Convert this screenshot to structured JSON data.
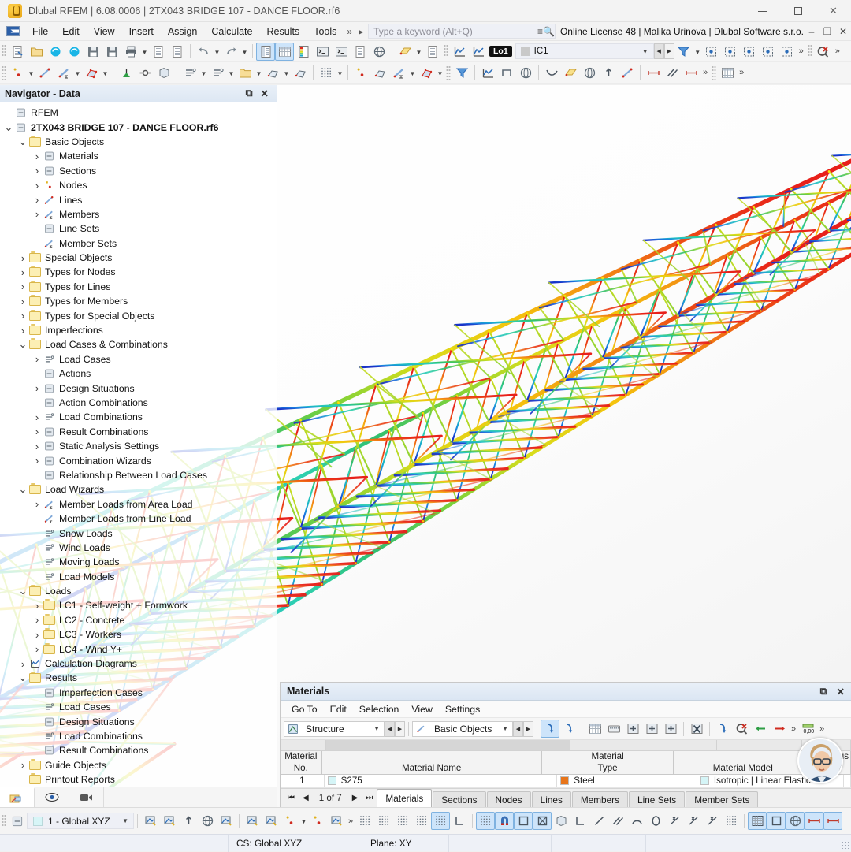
{
  "window": {
    "title": "Dlubal RFEM | 6.08.0006 | 2TX043 BRIDGE 107 - DANCE FLOOR.rf6",
    "app_icon": "dlubal-logo-icon",
    "minimize": "minimize-icon",
    "maximize": "maximize-icon",
    "close": "close-icon"
  },
  "menubar": {
    "items": [
      "File",
      "Edit",
      "View",
      "Insert",
      "Assign",
      "Calculate",
      "Results",
      "Tools"
    ],
    "overflow": "»",
    "expander": "▸",
    "search_placeholder": "Type a keyword (Alt+Q)",
    "license": "Online License 48 | Malika Urinova | Dlubal Software s.r.o.",
    "license_icon": "license-list-icon",
    "min": "–",
    "restore": "❐",
    "close": "✕"
  },
  "toolbar1": {
    "buttons": [
      "new-model-icon",
      "open-folder-icon",
      "cloud-connect-icon",
      "cloud-model-icon",
      "save-as-icon",
      "save-icon",
      "print-icon",
      "new-report-icon",
      "document-icon",
      "undo-icon",
      "redo-icon",
      "navigator-panel-icon",
      "table-panel-icon",
      "color-legend-icon",
      "console-icon",
      "script-icon",
      "info-panel-icon",
      "globe-view-icon",
      "section-plane-icon",
      "annotation-icon",
      "result-diagram-icon",
      "result-diagram2-icon",
      "filter-clear-icon",
      "visibility-icon",
      "deselect-icon",
      "select-down-icon",
      "select-all-icon",
      "box-select-icon",
      "delete-results-icon"
    ],
    "lo_badge": "Lo1",
    "ic_value": "IC1",
    "overflow": "»"
  },
  "toolbar2": {
    "buttons": [
      "new-node-icon",
      "new-line-icon",
      "new-member-icon",
      "new-surface-icon",
      "new-solid-icon",
      "new-support-icon",
      "new-hinge-icon",
      "new-load-icon",
      "wind-load-icon",
      "opening-icon",
      "rib-icon",
      "stiffener-icon",
      "mesh-icon",
      "node-set-icon",
      "line-grid-icon",
      "member-set-icon",
      "surface-set-icon",
      "filter-icon",
      "diagram-icon",
      "frame-icon",
      "render-icon",
      "deformation-icon",
      "plate-icon",
      "cube-view-icon",
      "move-icon",
      "line-tool-icon",
      "dim-horizontal-icon",
      "dim-dashed-icon",
      "dim-dotted-icon",
      "grid-table-icon"
    ],
    "overflow": "»"
  },
  "navigator": {
    "title": "Navigator - Data",
    "undock_icon": "undock-icon",
    "close_icon": "close-icon",
    "bottom_tabs": [
      "navigator-data-icon",
      "visibility-eye-icon",
      "camera-icon"
    ],
    "tree": [
      {
        "depth": 0,
        "chev": "",
        "icon": "rfem-icon",
        "label": "RFEM",
        "bold": false
      },
      {
        "depth": 0,
        "chev": "open",
        "icon": "model-icon",
        "label": "2TX043 BRIDGE 107 - DANCE FLOOR.rf6",
        "bold": true
      },
      {
        "depth": 1,
        "chev": "open",
        "icon": "folder",
        "label": "Basic Objects",
        "bold": false
      },
      {
        "depth": 2,
        "chev": "closed",
        "icon": "materials-icon",
        "label": "Materials",
        "bold": false
      },
      {
        "depth": 2,
        "chev": "closed",
        "icon": "sections-icon",
        "label": "Sections",
        "bold": false
      },
      {
        "depth": 2,
        "chev": "closed",
        "icon": "nodes-icon",
        "label": "Nodes",
        "bold": false
      },
      {
        "depth": 2,
        "chev": "closed",
        "icon": "lines-icon",
        "label": "Lines",
        "bold": false
      },
      {
        "depth": 2,
        "chev": "closed",
        "icon": "members-icon",
        "label": "Members",
        "bold": false
      },
      {
        "depth": 2,
        "chev": "",
        "icon": "line-sets-icon",
        "label": "Line Sets",
        "bold": false
      },
      {
        "depth": 2,
        "chev": "",
        "icon": "member-sets-icon",
        "label": "Member Sets",
        "bold": false
      },
      {
        "depth": 1,
        "chev": "closed",
        "icon": "folder",
        "label": "Special Objects",
        "bold": false
      },
      {
        "depth": 1,
        "chev": "closed",
        "icon": "folder",
        "label": "Types for Nodes",
        "bold": false
      },
      {
        "depth": 1,
        "chev": "closed",
        "icon": "folder",
        "label": "Types for Lines",
        "bold": false
      },
      {
        "depth": 1,
        "chev": "closed",
        "icon": "folder",
        "label": "Types for Members",
        "bold": false
      },
      {
        "depth": 1,
        "chev": "closed",
        "icon": "folder",
        "label": "Types for Special Objects",
        "bold": false
      },
      {
        "depth": 1,
        "chev": "closed",
        "icon": "folder",
        "label": "Imperfections",
        "bold": false
      },
      {
        "depth": 1,
        "chev": "open",
        "icon": "folder",
        "label": "Load Cases & Combinations",
        "bold": false
      },
      {
        "depth": 2,
        "chev": "closed",
        "icon": "load-cases-icon",
        "label": "Load Cases",
        "bold": false
      },
      {
        "depth": 2,
        "chev": "",
        "icon": "actions-icon",
        "label": "Actions",
        "bold": false
      },
      {
        "depth": 2,
        "chev": "closed",
        "icon": "design-situations-icon",
        "label": "Design Situations",
        "bold": false
      },
      {
        "depth": 2,
        "chev": "",
        "icon": "action-combinations-icon",
        "label": "Action Combinations",
        "bold": false
      },
      {
        "depth": 2,
        "chev": "closed",
        "icon": "load-combinations-icon",
        "label": "Load Combinations",
        "bold": false
      },
      {
        "depth": 2,
        "chev": "closed",
        "icon": "result-combinations-icon",
        "label": "Result Combinations",
        "bold": false
      },
      {
        "depth": 2,
        "chev": "closed",
        "icon": "static-analysis-icon",
        "label": "Static Analysis Settings",
        "bold": false
      },
      {
        "depth": 2,
        "chev": "closed",
        "icon": "combination-wizards-icon",
        "label": "Combination Wizards",
        "bold": false
      },
      {
        "depth": 2,
        "chev": "",
        "icon": "relationship-icon",
        "label": "Relationship Between Load Cases",
        "bold": false
      },
      {
        "depth": 1,
        "chev": "open",
        "icon": "folder",
        "label": "Load Wizards",
        "bold": false
      },
      {
        "depth": 2,
        "chev": "closed",
        "icon": "member-loads-area-icon",
        "label": "Member Loads from Area Load",
        "bold": false
      },
      {
        "depth": 2,
        "chev": "",
        "icon": "member-loads-line-icon",
        "label": "Member Loads from Line Load",
        "bold": false
      },
      {
        "depth": 2,
        "chev": "",
        "icon": "snow-loads-icon",
        "label": "Snow Loads",
        "bold": false
      },
      {
        "depth": 2,
        "chev": "",
        "icon": "wind-loads-icon",
        "label": "Wind Loads",
        "bold": false
      },
      {
        "depth": 2,
        "chev": "",
        "icon": "moving-loads-icon",
        "label": "Moving Loads",
        "bold": false
      },
      {
        "depth": 2,
        "chev": "",
        "icon": "load-models-icon",
        "label": "Load Models",
        "bold": false
      },
      {
        "depth": 1,
        "chev": "open",
        "icon": "folder",
        "label": "Loads",
        "bold": false
      },
      {
        "depth": 2,
        "chev": "closed",
        "icon": "folder",
        "label": "LC1 - Self-weight + Formwork",
        "bold": false
      },
      {
        "depth": 2,
        "chev": "closed",
        "icon": "folder",
        "label": "LC2 - Concrete",
        "bold": false
      },
      {
        "depth": 2,
        "chev": "closed",
        "icon": "folder",
        "label": "LC3 - Workers",
        "bold": false
      },
      {
        "depth": 2,
        "chev": "closed",
        "icon": "folder",
        "label": "LC4 - Wind Y+",
        "bold": false
      },
      {
        "depth": 1,
        "chev": "closed",
        "icon": "calculation-diagrams-icon",
        "label": "Calculation Diagrams",
        "bold": false
      },
      {
        "depth": 1,
        "chev": "open",
        "icon": "folder",
        "label": "Results",
        "bold": false
      },
      {
        "depth": 2,
        "chev": "",
        "icon": "imperfection-cases-icon",
        "label": "Imperfection Cases",
        "bold": false
      },
      {
        "depth": 2,
        "chev": "",
        "icon": "load-cases-icon",
        "label": "Load Cases",
        "bold": false
      },
      {
        "depth": 2,
        "chev": "",
        "icon": "design-situations-icon",
        "label": "Design Situations",
        "bold": false
      },
      {
        "depth": 2,
        "chev": "",
        "icon": "load-combinations-icon",
        "label": "Load Combinations",
        "bold": false
      },
      {
        "depth": 2,
        "chev": "",
        "icon": "result-combinations-icon",
        "label": "Result Combinations",
        "bold": false
      },
      {
        "depth": 1,
        "chev": "closed",
        "icon": "folder",
        "label": "Guide Objects",
        "bold": false
      },
      {
        "depth": 1,
        "chev": "",
        "icon": "folder",
        "label": "Printout Reports",
        "bold": false
      }
    ]
  },
  "table_panel": {
    "title": "Materials",
    "undock_icon": "undock-icon",
    "close_icon": "close-icon",
    "menu": [
      "Go To",
      "Edit",
      "Selection",
      "View",
      "Settings"
    ],
    "combo1": {
      "icon": "structure-icon",
      "value": "Structure"
    },
    "combo2": {
      "icon": "basic-objects-icon",
      "value": "Basic Objects"
    },
    "tool_icons": [
      "select-in-table-icon",
      "select-in-model-icon",
      "table-view-icon",
      "keyboard-icon",
      "insert-row-icon",
      "insert-cell-icon",
      "column-icon",
      "delete-row-icon",
      "export-icon",
      "clear-icon",
      "import-green-icon",
      "export-red-icon"
    ],
    "overflow": "»",
    "decimals_icon": "decimal-places-icon",
    "decimals_value": "0,00",
    "columns": [
      "Material No.",
      "Material Name",
      "Material Type",
      "Material Model",
      "Modulus E [N/"
    ],
    "columns_multiline": [
      [
        "Material",
        "No."
      ],
      [
        "",
        "Material Name"
      ],
      [
        "Material",
        "Type"
      ],
      [
        "",
        "Material Model"
      ],
      [
        "Modulus",
        "E [N/"
      ]
    ],
    "rows": [
      {
        "no": "1",
        "name": "S275",
        "name_color": "#d5f5f7",
        "type": "Steel",
        "type_color": "#e8751a",
        "model": "Isotropic | Linear Elastic",
        "model_color": "#d5f5f7",
        "modulus": ""
      }
    ],
    "pager": {
      "first": "⏮",
      "prev": "◀",
      "page": "1 of 7",
      "next": "▶",
      "last": "⏭"
    },
    "tabs": [
      "Materials",
      "Sections",
      "Nodes",
      "Lines",
      "Members",
      "Line Sets",
      "Member Sets"
    ],
    "selected_tab": "Materials",
    "avatar": "user-avatar"
  },
  "bottombar": {
    "cs_icon": "coordinate-system-icon",
    "cs_value": "1 - Global XYZ",
    "left_icons": [
      "view-model-icon",
      "view-delete-icon",
      "view-extrude-icon",
      "view-rotate-icon",
      "view-layers-icon",
      "snap-object-icon",
      "snap-grid-icon",
      "snap-point-icon",
      "snap-point2-icon",
      "snap-intersect-icon"
    ],
    "overflow": "»",
    "right_icons": [
      "grid-snap-icon",
      "grid-point-icon",
      "grid-object-icon",
      "grid-line-icon",
      "grid-visible-icon",
      "axis-icon",
      "osnap-grid-icon",
      "osnap-magnet-icon",
      "osnap-square-icon",
      "osnap-cross-icon",
      "osnap-box-icon",
      "osnap-corner-icon",
      "osnap-line-icon",
      "osnap-parallel-icon",
      "osnap-arc-icon",
      "osnap-circle-icon",
      "osnap-perp-icon",
      "osnap-tangent-icon",
      "osnap-extend-icon",
      "osnap-dots-icon",
      "work-plane-icon",
      "work-area-icon",
      "render-mode-icon",
      "dimension-icon",
      "measure-icon"
    ]
  },
  "statusbar": {
    "cells": [
      "",
      "CS: Global XYZ",
      "Plane: XY",
      "",
      "",
      ""
    ],
    "resize_grip": "resize-grip-icon"
  },
  "viewport": {
    "name": "3d-model-viewport",
    "description": "3D rendered steel truss bridge with colored deformation/result gradient",
    "colors": {
      "high": "#e8201a",
      "mid_high": "#f28a14",
      "mid": "#d8dd1b",
      "mid_low": "#31c070",
      "low": "#1bb7c8",
      "lowest": "#1a33c8"
    }
  }
}
